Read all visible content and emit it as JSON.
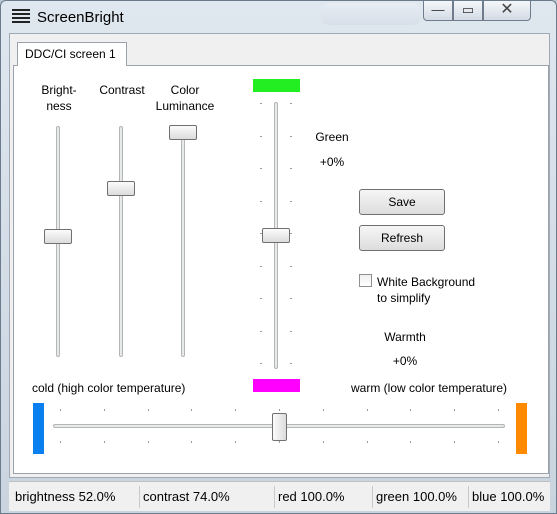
{
  "window": {
    "title": "ScreenBright",
    "minimize": "—",
    "maximize": "▭",
    "close": "✕"
  },
  "tab": {
    "label": "DDC/CI screen 1"
  },
  "sliders": {
    "brightness": {
      "label": "Bright-\nness",
      "level_pct": 52
    },
    "contrast": {
      "label": "Contrast",
      "level_pct": 74
    },
    "color_luminance": {
      "label": "Color\nLuminance",
      "level_pct": 100
    }
  },
  "color_balance": {
    "color": "#22ee22",
    "name": "Green",
    "value": "+0%"
  },
  "buttons": {
    "save": "Save",
    "refresh": "Refresh"
  },
  "white_background": {
    "label": "White Background\nto simplify",
    "checked": false
  },
  "warmth": {
    "label": "Warmth",
    "value": "+0%",
    "cold_label": "cold (high color temperature)",
    "warm_label": "warm (low color temperature)",
    "indicator_color": "#ff00ff",
    "cold_color": "#0a7ff0",
    "warm_color": "#ff8a00",
    "level_pct": 50
  },
  "status": {
    "brightness": "brightness 52.0%",
    "contrast": "contrast 74.0%",
    "red": "red 100.0%",
    "green": "green 100.0%",
    "blue": "blue 100.0%"
  }
}
